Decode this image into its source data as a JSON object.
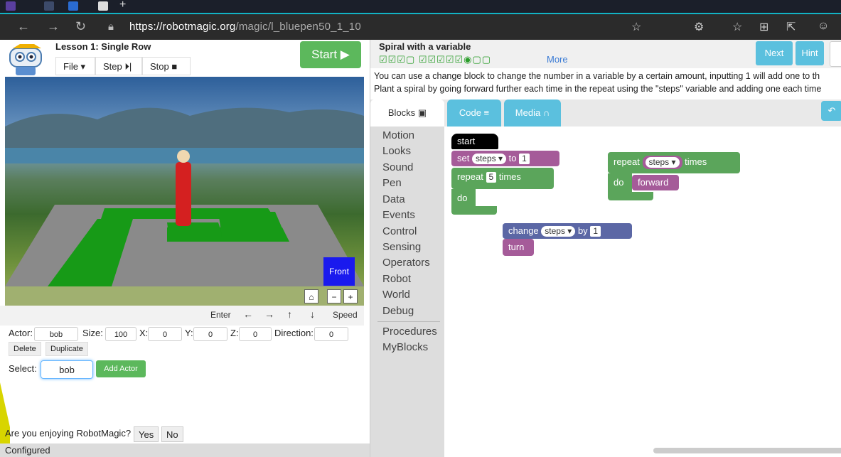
{
  "browser": {
    "url_base": "https://robotmagic.org",
    "url_path": "/magic/l_bluepen50_1_10"
  },
  "header": {
    "lesson_title": "Lesson 1: Single Row",
    "file_label": "File ▾",
    "step_label": "Step ⏵|",
    "stop_label": "Stop ■",
    "start_label": "Start ▶"
  },
  "scene": {
    "front_label": "Front"
  },
  "controls": {
    "enter_label": "Enter",
    "speed_label": "Speed"
  },
  "actor": {
    "actor_label": "Actor:",
    "actor_value": "bob",
    "size_label": "Size:",
    "size_value": "100",
    "x_label": "X:",
    "x_value": "0",
    "y_label": "Y:",
    "y_value": "0",
    "z_label": "Z:",
    "z_value": "0",
    "direction_label": "Direction:",
    "direction_value": "0",
    "delete_label": "Delete",
    "duplicate_label": "Duplicate",
    "select_label": "Select:",
    "select_value": "bob",
    "add_actor_label": "Add Actor"
  },
  "feedback": {
    "question": "Are you enjoying RobotMagic?",
    "yes": "Yes",
    "no": "No"
  },
  "status": "Configured",
  "task": {
    "title": "Spiral with a variable",
    "progress_glyphs": "☑☑☑▢ ☑☑☑☑☑◉▢▢",
    "more": "More",
    "next": "Next",
    "hint": "Hint",
    "line1": "You can use a change block to change the number in a variable by a certain amount, inputting 1 will add one to th",
    "line2": "Plant a spiral by going forward further each time in the repeat using the \"steps\" variable and adding one each time"
  },
  "tabs": {
    "blocks": "Blocks",
    "code": "Code",
    "media": "Media"
  },
  "categories": [
    "Motion",
    "Looks",
    "Sound",
    "Pen",
    "Data",
    "Events",
    "Control",
    "Sensing",
    "Operators",
    "Robot",
    "World",
    "Debug",
    "Procedures",
    "MyBlocks"
  ],
  "blocks": {
    "start": "start",
    "set": "set",
    "steps": "steps",
    "to": "to",
    "one": "1",
    "repeat": "repeat",
    "five": "5",
    "times": "times",
    "do": "do",
    "forward": "forward",
    "change": "change",
    "by": "by",
    "turn": "turn"
  }
}
